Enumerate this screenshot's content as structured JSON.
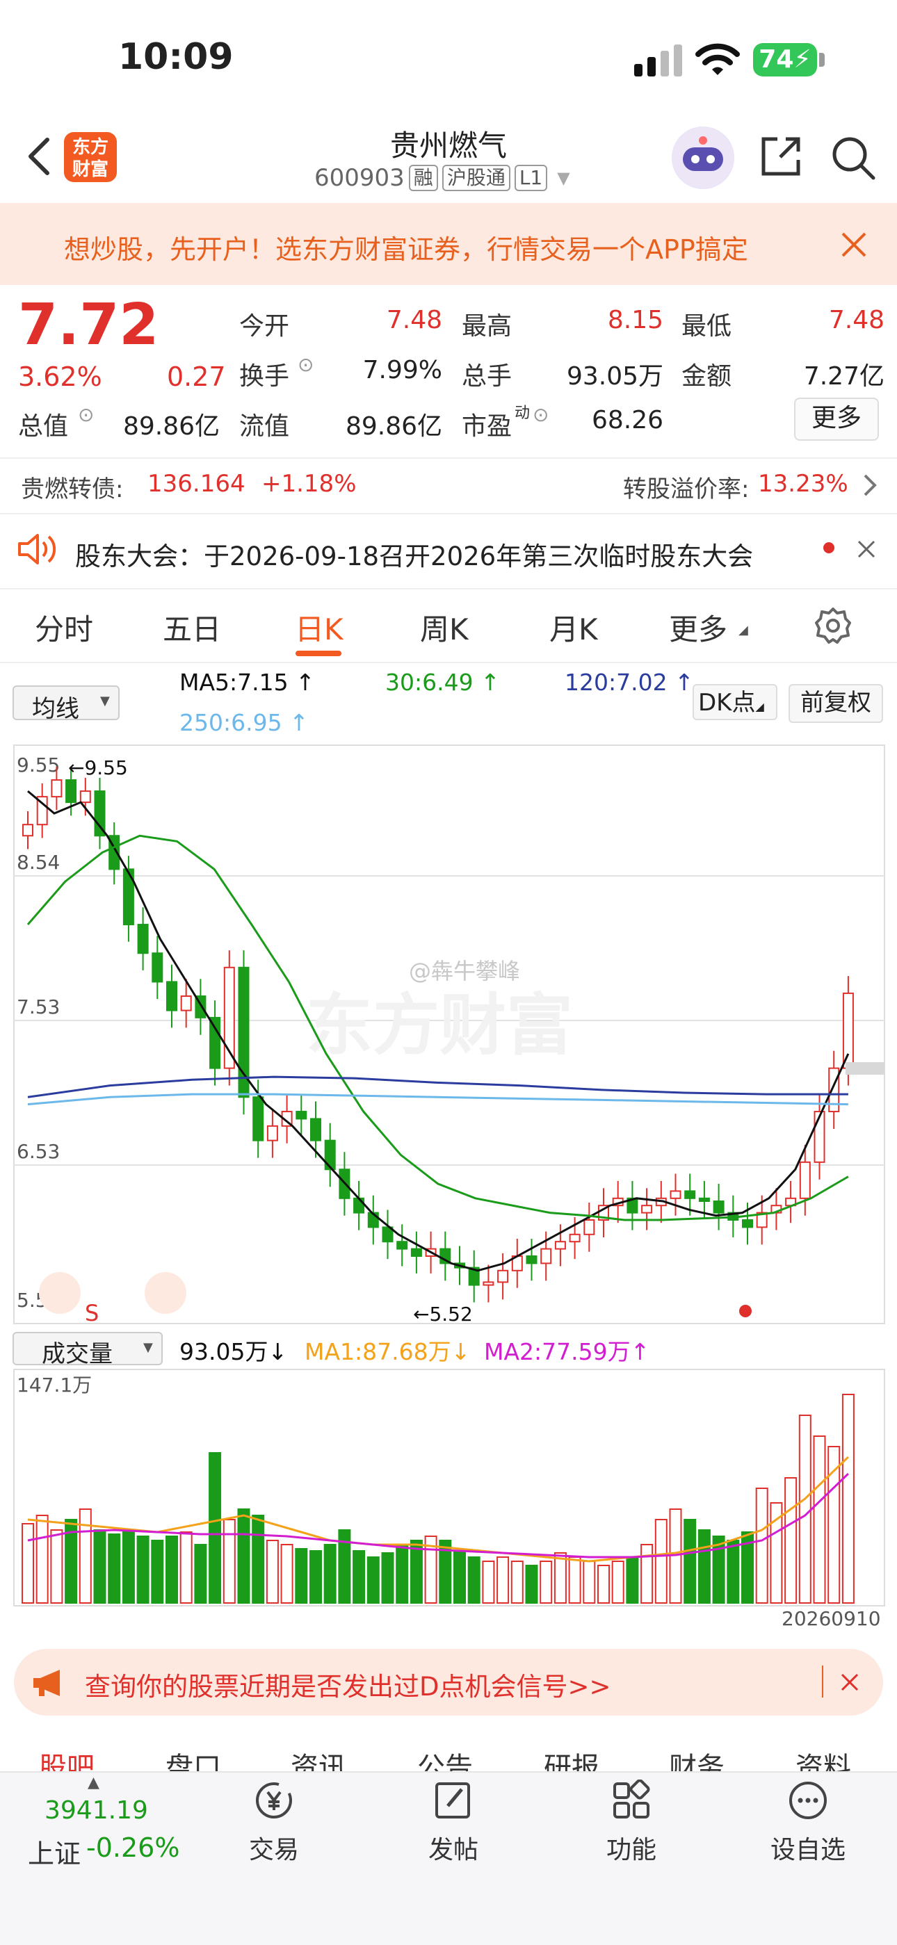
{
  "status_bar": {
    "time": "10:09",
    "battery": "74"
  },
  "header": {
    "logo_line1": "东方",
    "logo_line2": "财富",
    "stock_name": "贵州燃气",
    "stock_code": "600903",
    "tags": [
      "融",
      "沪股通",
      "L1"
    ]
  },
  "banner": {
    "text": "想炒股，先开户！选东方财富证券，行情交易一个APP搞定"
  },
  "quote": {
    "price": "7.72",
    "change_pct": "3.62%",
    "change": "0.27",
    "fields": {
      "open_label": "今开",
      "open": "7.48",
      "high_label": "最高",
      "high": "8.15",
      "low_label": "最低",
      "low": "7.48",
      "turnover_label": "换手",
      "turnover": "7.99%",
      "volume_label": "总手",
      "volume": "93.05万",
      "amount_label": "金额",
      "amount": "7.27亿",
      "mktcap_label": "总值",
      "mktcap": "89.86亿",
      "float_label": "流值",
      "float": "89.86亿",
      "pe_label": "市盈",
      "pe_sup": "动",
      "pe": "68.26"
    },
    "more_label": "更多"
  },
  "bond": {
    "label": "贵燃转债:",
    "price": "136.164",
    "change": "+1.18%",
    "premium_label": "转股溢价率:",
    "premium": "13.23%"
  },
  "notice": {
    "text": "股东大会：于2026-09-18召开2026年第三次临时股东大会"
  },
  "period_tabs": [
    "分时",
    "五日",
    "日K",
    "周K",
    "月K",
    "更多"
  ],
  "active_tab": "日K",
  "ma_bar": {
    "selector": "均线",
    "ma5": "MA5:7.15",
    "ma30": "30:6.49",
    "ma120": "120:7.02",
    "ma250": "250:6.95",
    "dk_button": "DK点",
    "adjust_button": "前复权"
  },
  "kline": {
    "y_ticks": [
      "9.55",
      "8.54",
      "7.53",
      "6.53",
      "5.52"
    ],
    "max_marker": "9.55",
    "min_marker": "5.52",
    "signal_label": "S",
    "watermark": "东方财富",
    "credit": "@犇牛攀峰"
  },
  "volume_bar": {
    "selector": "成交量",
    "vol": "93.05万",
    "ma1": "MA1:87.68万",
    "ma2": "MA2:77.59万",
    "max_label": "147.1万",
    "end_date": "20260910"
  },
  "colors": {
    "up": "#e0302c",
    "down": "#1a9b1a",
    "accent": "#f25a21",
    "ma5": "#111111",
    "ma30": "#1a9b1a",
    "ma120": "#2a3d9e",
    "ma250": "#6cb8ea",
    "vol_ma1": "#f3a21a",
    "vol_ma2": "#d21ed0"
  },
  "d_notice": {
    "text": "查询你的股票近期是否发出过D点机会信号>>"
  },
  "sub_tabs": [
    "股吧",
    "盘口",
    "资讯",
    "公告",
    "研报",
    "财务",
    "资料"
  ],
  "bottom_bar": {
    "index_value": "3941.19",
    "index_name": "上证",
    "index_change": "-0.26%",
    "items": [
      "交易",
      "发帖",
      "功能",
      "设自选"
    ]
  }
}
